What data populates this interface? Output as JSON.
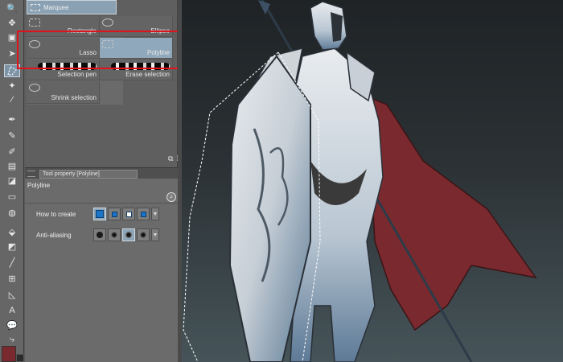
{
  "subtool": {
    "marquee_tab": "Marquee",
    "items": [
      {
        "label": "Rectangle"
      },
      {
        "label": "Ellipse"
      },
      {
        "label": "Lasso"
      },
      {
        "label": "Polyline"
      },
      {
        "label": "Selection pen"
      },
      {
        "label": "Erase selection"
      },
      {
        "label": "Shrink selection"
      }
    ]
  },
  "tool_property": {
    "tab_label": "Tool property [Polyline]",
    "title": "Polyline",
    "rows": [
      {
        "label": "How to create"
      },
      {
        "label": "Anti-aliasing"
      }
    ]
  },
  "toolbar": {
    "icons": [
      "zoom-icon",
      "move-icon",
      "object-icon",
      "selection-icon",
      "polyline-icon",
      "auto-select-icon",
      "eyedropper-icon",
      "pen-icon",
      "pencil-icon",
      "brush-icon",
      "airbrush-icon",
      "decoration-icon",
      "eraser-icon",
      "blend-icon",
      "fill-icon",
      "gradient-icon",
      "figure-icon",
      "frame-icon",
      "ruler-icon",
      "text-icon",
      "balloon-icon",
      "correction-icon"
    ],
    "main_color": "#7a2a2e",
    "sub_color": "#2b2b2b"
  },
  "colors": {
    "accent_selected": "#90a8bb",
    "highlight_box": "#e2121a"
  }
}
